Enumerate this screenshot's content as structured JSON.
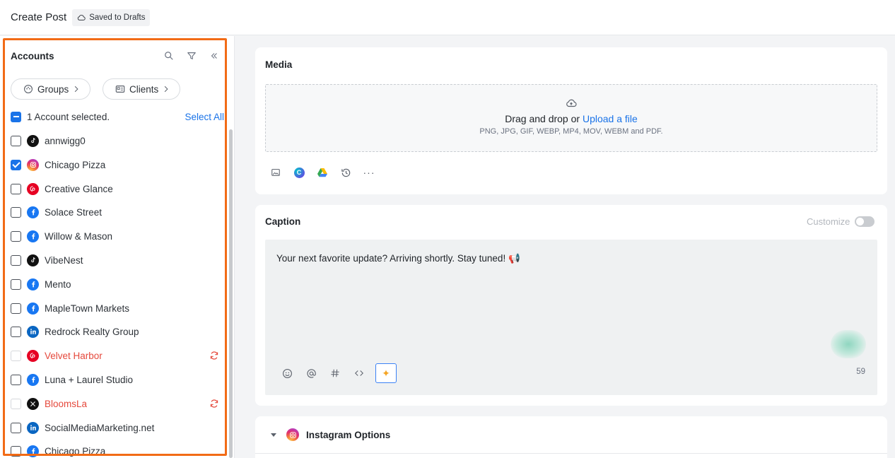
{
  "header": {
    "title": "Create Post",
    "draft_status": "Saved to Drafts"
  },
  "accounts_panel": {
    "heading": "Accounts",
    "groups_label": "Groups",
    "clients_label": "Clients",
    "selected_text": "1 Account selected.",
    "select_all": "Select All",
    "accounts": [
      {
        "name": "annwigg0",
        "platform": "tiktok",
        "checked": false,
        "error": false
      },
      {
        "name": "Chicago Pizza",
        "platform": "instagram",
        "checked": true,
        "error": false
      },
      {
        "name": "Creative Glance",
        "platform": "pinterest",
        "checked": false,
        "error": false
      },
      {
        "name": "Solace Street",
        "platform": "facebook",
        "checked": false,
        "error": false
      },
      {
        "name": "Willow & Mason",
        "platform": "facebook",
        "checked": false,
        "error": false
      },
      {
        "name": "VibeNest",
        "platform": "tiktok",
        "checked": false,
        "error": false
      },
      {
        "name": "Mento",
        "platform": "facebook",
        "checked": false,
        "error": false
      },
      {
        "name": "MapleTown Markets",
        "platform": "facebook",
        "checked": false,
        "error": false
      },
      {
        "name": "Redrock Realty Group",
        "platform": "linkedin",
        "checked": false,
        "error": false
      },
      {
        "name": "Velvet Harbor",
        "platform": "pinterest",
        "checked": false,
        "error": true
      },
      {
        "name": "Luna + Laurel Studio",
        "platform": "facebook",
        "checked": false,
        "error": false
      },
      {
        "name": "BloomsLa",
        "platform": "x",
        "checked": false,
        "error": true
      },
      {
        "name": "SocialMediaMarketing.net",
        "platform": "linkedin",
        "checked": false,
        "error": false
      },
      {
        "name": "Chicago Pizza",
        "platform": "facebook",
        "checked": false,
        "error": false
      }
    ]
  },
  "media": {
    "title": "Media",
    "drag_text": "Drag and drop or ",
    "upload_link": "Upload a file",
    "formats": "PNG, JPG, GIF, WEBP, MP4, MOV, WEBM and PDF."
  },
  "caption": {
    "title": "Caption",
    "customize_label": "Customize",
    "text": "Your next favorite update? Arriving shortly. Stay tuned! 📢",
    "char_count": "59"
  },
  "instagram_options": {
    "title": "Instagram Options"
  },
  "colors": {
    "accent": "#1a73e8",
    "highlight": "#f26b16",
    "error": "#e5483b"
  }
}
